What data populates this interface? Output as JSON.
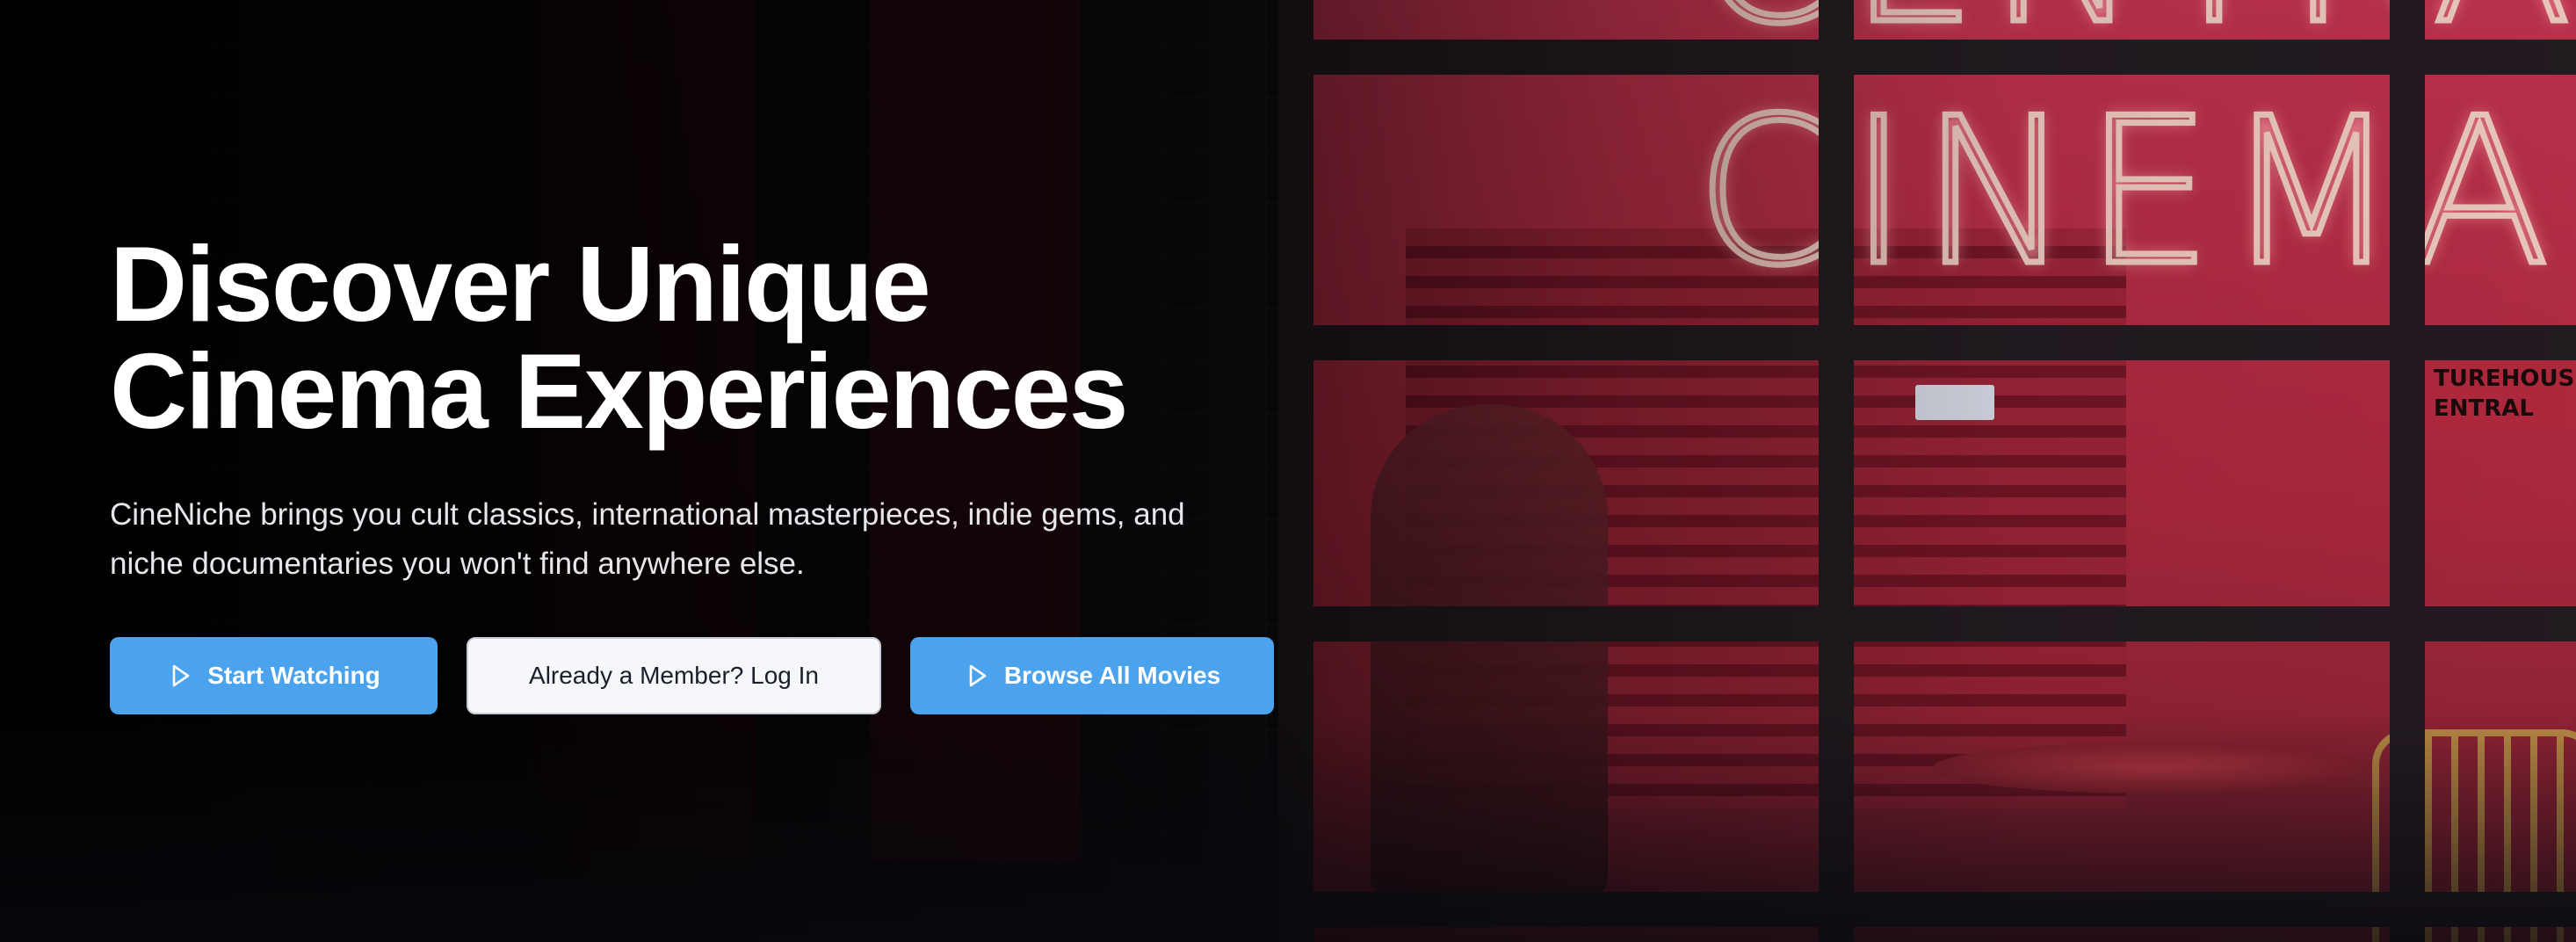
{
  "hero": {
    "headline_line1": "Discover Unique",
    "headline_line2": "Cinema Experiences",
    "subtitle_line1": "CineNiche brings you cult classics, international masterpieces, indie gems, and",
    "subtitle_line2": "niche documentaries you won't find anywhere else."
  },
  "buttons": {
    "start_label": "Start Watching",
    "login_label": "Already a Member? Log In",
    "browse_label": "Browse All Movies"
  },
  "icons": {
    "start": "play-icon",
    "browse": "play-icon"
  },
  "colors": {
    "primary_button": "#4aa3ec",
    "outline_button_bg": "#f5f7fa",
    "headline_text": "#ffffff"
  }
}
